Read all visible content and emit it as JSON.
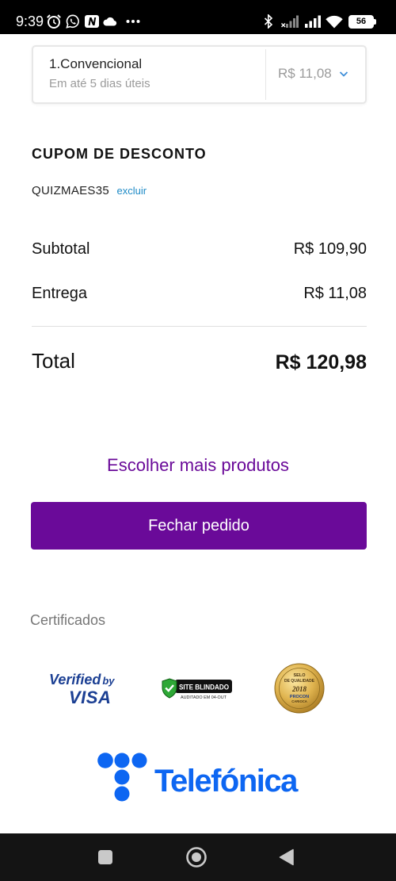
{
  "status_bar": {
    "time": "9:39",
    "battery_level": "56",
    "left_icons": [
      "alarm-icon",
      "whatsapp-icon",
      "n-app-icon",
      "cloud-icon",
      "more-notifications-icon"
    ],
    "right_icons": [
      "bluetooth-icon",
      "signal-no-sim-icon",
      "signal-icon",
      "wifi-icon",
      "battery-icon"
    ]
  },
  "shipping_option": {
    "name": "1.Convencional",
    "eta": "Em até 5 dias úteis",
    "price": "R$ 11,08",
    "expand_icon": "chevron-down-icon"
  },
  "coupon": {
    "heading": "CUPOM DE DESCONTO",
    "code": "QUIZMAES35",
    "remove_label": "excluir"
  },
  "summary": {
    "subtotal": {
      "label": "Subtotal",
      "value": "R$ 109,90"
    },
    "delivery": {
      "label": "Entrega",
      "value": "R$ 11,08"
    },
    "total": {
      "label": "Total",
      "value": "R$ 120,98"
    }
  },
  "actions": {
    "continue_shopping": "Escolher mais produtos",
    "checkout": "Fechar pedido"
  },
  "certificates": {
    "heading": "Certificados",
    "visa": {
      "verified": "Verified",
      "by": "by",
      "brand": "VISA"
    },
    "site_blindado": {
      "title": "SITE BLINDADO",
      "subtitle": "AUDITADO EM 04-OUT"
    },
    "procon_seal": {
      "top": "SELO",
      "middle": "DE QUALIDADE",
      "year": "2018",
      "org": "PROCON",
      "region": "CARIOCA"
    }
  },
  "footer_brand": {
    "name": "Telefónica",
    "icon": "telefonica-dots-logo"
  },
  "nav_bar": {
    "icons": [
      "recent-apps-icon",
      "home-icon",
      "back-icon"
    ]
  },
  "colors": {
    "accent": "#6a0a99",
    "link": "#1d8ac6",
    "chevron": "#3f8ed8",
    "brand": "#0d66f2",
    "status_bar": "#000000",
    "nav_bar": "#141414"
  }
}
